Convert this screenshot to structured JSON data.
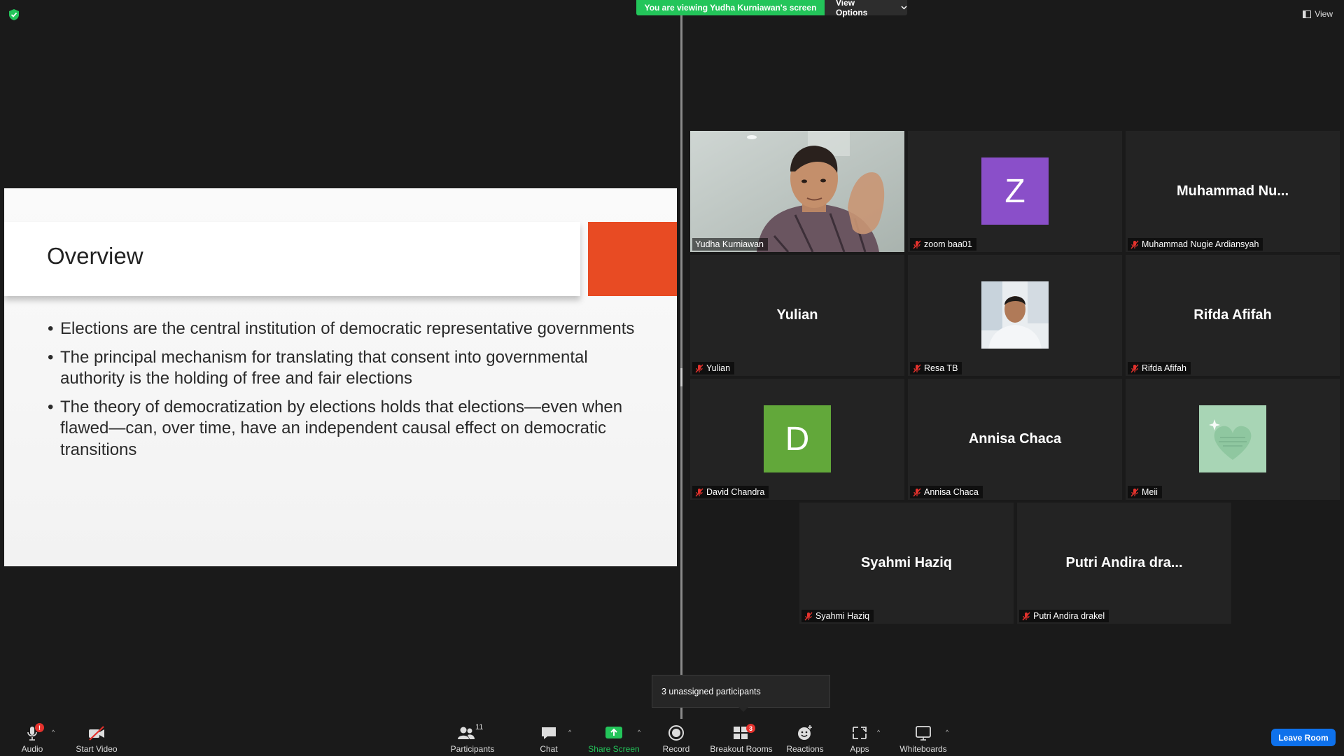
{
  "top_bar": {
    "viewing_banner": "You are viewing Yudha Kurniawan's screen",
    "view_options_label": "View Options",
    "view_label": "View"
  },
  "slide": {
    "title": "Overview",
    "accent_color": "#e84b23",
    "bullets": [
      "Elections are the central institution of democratic representative governments",
      "The principal mechanism for translating that consent into governmental authority is the holding of free and fair elections",
      "The theory of democratization by elections holds that elections—even when flawed—can, over time, have an independent causal effect on democratic transitions"
    ]
  },
  "gallery": {
    "tiles": [
      {
        "label": "Yudha Kurniawan",
        "kind": "video",
        "active": true,
        "muted": false
      },
      {
        "label": "zoom baa01",
        "kind": "letter",
        "letter": "Z",
        "color": "#8a4fc9",
        "muted": true
      },
      {
        "label": "Muhammad Nugie Ardiansyah",
        "display_name": "Muhammad  Nu...",
        "kind": "name",
        "muted": true
      },
      {
        "label": "Yulian",
        "display_name": "Yulian",
        "kind": "name",
        "muted": true
      },
      {
        "label": "Resa TB",
        "kind": "photo",
        "muted": true
      },
      {
        "label": "Rifda Afifah",
        "display_name": "Rifda Afifah",
        "kind": "name",
        "muted": true
      },
      {
        "label": "David Chandra",
        "kind": "letter",
        "letter": "D",
        "color": "#62a83a",
        "muted": true
      },
      {
        "label": "Annisa Chaca",
        "display_name": "Annisa Chaca",
        "kind": "name",
        "muted": true
      },
      {
        "label": "Meii",
        "kind": "image",
        "muted": true
      },
      {
        "label": "Syahmi Haziq",
        "display_name": "Syahmi Haziq",
        "kind": "name",
        "muted": true
      },
      {
        "label": "Putri Andira drakel",
        "display_name": "Putri Andira dra...",
        "kind": "name",
        "muted": true
      }
    ]
  },
  "tooltip": {
    "text": "3 unassigned participants"
  },
  "toolbar": {
    "audio": {
      "label": "Audio",
      "badge": "!"
    },
    "start_video": {
      "label": "Start Video"
    },
    "participants": {
      "label": "Participants",
      "count": "11"
    },
    "chat": {
      "label": "Chat"
    },
    "share_screen": {
      "label": "Share Screen"
    },
    "record": {
      "label": "Record"
    },
    "breakout_rooms": {
      "label": "Breakout Rooms",
      "badge": "3"
    },
    "reactions": {
      "label": "Reactions"
    },
    "apps": {
      "label": "Apps"
    },
    "whiteboards": {
      "label": "Whiteboards"
    },
    "leave_room": {
      "label": "Leave Room"
    }
  },
  "colors": {
    "banner_green": "#23c55a",
    "leave_blue": "#0e71eb",
    "active_speaker_outline": "#e8ee6e",
    "muted_red": "#e5322d"
  }
}
